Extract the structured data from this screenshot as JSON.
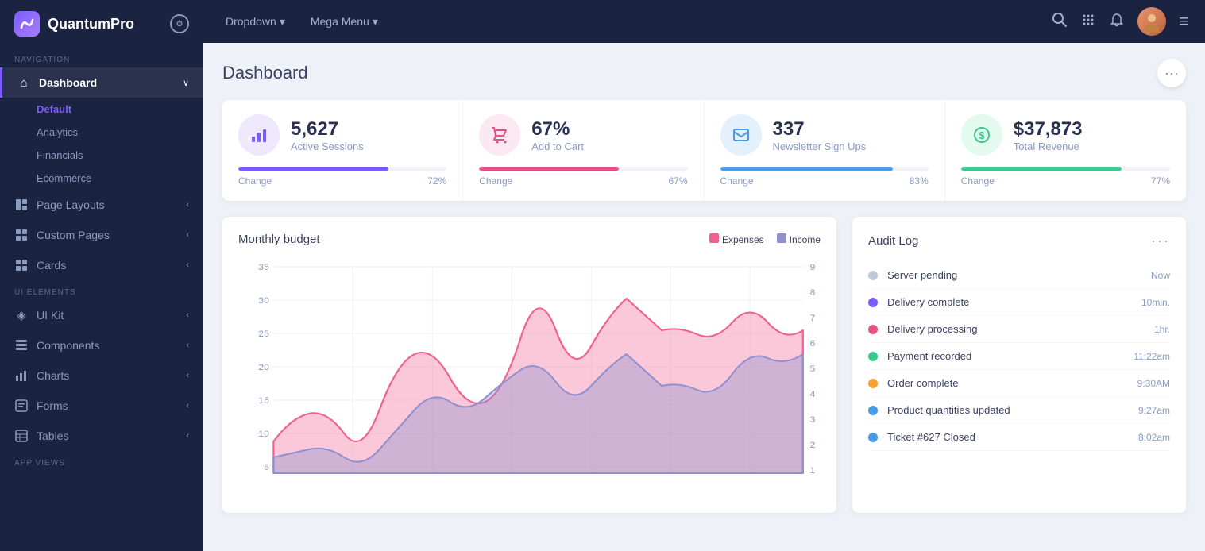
{
  "app": {
    "name": "QuantumPro",
    "logo_icon": "Q"
  },
  "topnav": {
    "items": [
      {
        "label": "Dropdown",
        "has_chevron": true
      },
      {
        "label": "Mega Menu",
        "has_chevron": true
      }
    ],
    "icons": [
      "search",
      "grid",
      "bell"
    ],
    "hamburger": "≡"
  },
  "sidebar": {
    "nav_section": "NAVIGATION",
    "ui_section": "UI ELEMENTS",
    "app_section": "APP VIEWS",
    "items": [
      {
        "label": "Dashboard",
        "icon": "⌂",
        "active": true,
        "has_chevron": true
      },
      {
        "label": "Default",
        "sub": true,
        "active": true
      },
      {
        "label": "Analytics",
        "sub": true
      },
      {
        "label": "Financials",
        "sub": true
      },
      {
        "label": "Ecommerce",
        "sub": true
      },
      {
        "label": "Page Layouts",
        "icon": "▤",
        "has_chevron": true
      },
      {
        "label": "Custom Pages",
        "icon": "▦",
        "has_chevron": true
      },
      {
        "label": "Cards",
        "icon": "⊞",
        "has_chevron": true
      },
      {
        "label": "UI Kit",
        "icon": "◈",
        "has_chevron": true
      },
      {
        "label": "Components",
        "icon": "▣",
        "has_chevron": true
      },
      {
        "label": "Charts",
        "icon": "▮",
        "has_chevron": true
      },
      {
        "label": "Forms",
        "icon": "▤",
        "has_chevron": true
      },
      {
        "label": "Tables",
        "icon": "▤",
        "has_chevron": true
      }
    ]
  },
  "page": {
    "title": "Dashboard",
    "menu_dots": "···"
  },
  "stats": [
    {
      "value": "5,627",
      "label": "Active Sessions",
      "change_label": "Change",
      "change_pct": "72%",
      "bar_pct": 72,
      "bar_color": "#7c5cfc",
      "icon_class": "stat-icon-purple",
      "icon": "📊"
    },
    {
      "value": "67%",
      "label": "Add to Cart",
      "change_label": "Change",
      "change_pct": "67%",
      "bar_pct": 67,
      "bar_color": "#e8508a",
      "icon_class": "stat-icon-pink",
      "icon": "🛒"
    },
    {
      "value": "337",
      "label": "Newsletter Sign Ups",
      "change_label": "Change",
      "change_pct": "83%",
      "bar_pct": 83,
      "bar_color": "#4a9ae8",
      "icon_class": "stat-icon-blue",
      "icon": "✉"
    },
    {
      "value": "$37,873",
      "label": "Total Revenue",
      "change_label": "Change",
      "change_pct": "77%",
      "bar_pct": 77,
      "bar_color": "#3ac890",
      "icon_class": "stat-icon-green",
      "icon": "$"
    }
  ],
  "monthly_budget": {
    "title": "Monthly budget",
    "legend": [
      {
        "label": "Expenses",
        "color": "#f06090"
      },
      {
        "label": "Income",
        "color": "#9090d0"
      }
    ],
    "y_labels_left": [
      "35",
      "30",
      "25",
      "20",
      "15",
      "10",
      "5"
    ],
    "y_labels_right": [
      "9",
      "8",
      "7",
      "6",
      "5",
      "4",
      "3",
      "2",
      "1"
    ]
  },
  "audit_log": {
    "title": "Audit Log",
    "menu_dots": "···",
    "items": [
      {
        "text": "Server pending",
        "time": "Now",
        "dot_color": "#c0c8d8"
      },
      {
        "text": "Delivery complete",
        "time": "10min.",
        "dot_color": "#7c5cfc"
      },
      {
        "text": "Delivery processing",
        "time": "1hr.",
        "dot_color": "#e8508a"
      },
      {
        "text": "Payment recorded",
        "time": "11:22am",
        "dot_color": "#3ac890"
      },
      {
        "text": "Order complete",
        "time": "9:30AM",
        "dot_color": "#f8a030"
      },
      {
        "text": "Product quantities updated",
        "time": "9:27am",
        "dot_color": "#4a9ae8"
      },
      {
        "text": "Ticket #627 Closed",
        "time": "8:02am",
        "dot_color": "#4a9ae8"
      }
    ]
  }
}
